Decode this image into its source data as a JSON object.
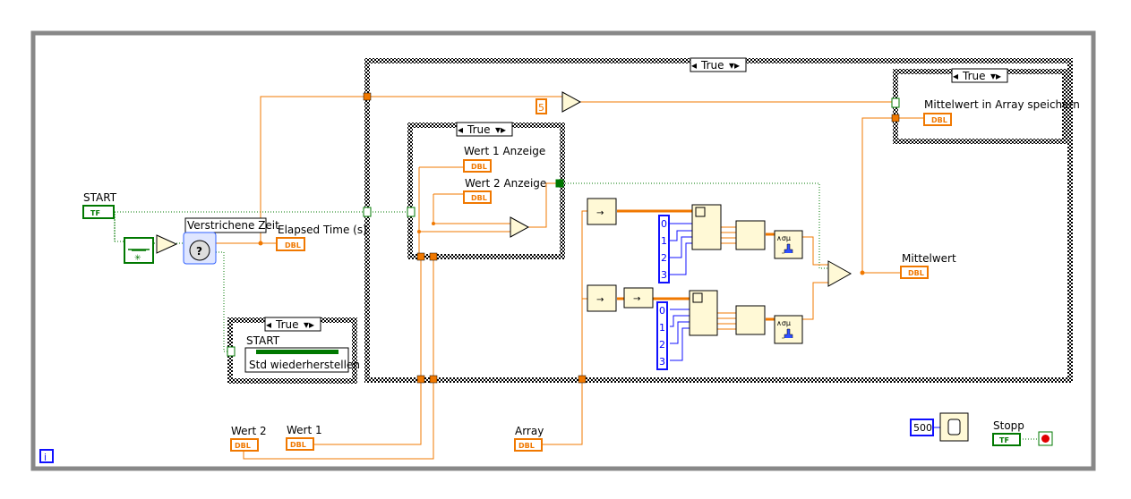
{
  "case_selector_value": "True",
  "controls": {
    "start": {
      "label": "START",
      "type": "TF"
    },
    "wert1": {
      "label": "Wert 1",
      "type": "DBL"
    },
    "wert2": {
      "label": "Wert 2",
      "type": "DBL"
    },
    "array": {
      "label": "Array",
      "type": "DBL"
    },
    "stopp": {
      "label": "Stopp",
      "type": "TF"
    }
  },
  "indicators": {
    "elapsed_time": {
      "label": "Elapsed Time (s)",
      "type": "DBL"
    },
    "wert1_anzeige": {
      "label": "Wert 1 Anzeige",
      "type": "DBL"
    },
    "wert2_anzeige": {
      "label": "Wert 2 Anzeige",
      "type": "DBL"
    },
    "mittelwert_array": {
      "label": "Mittelwert in Array speichern",
      "type": "DBL"
    },
    "mittelwert": {
      "label": "Mittelwert",
      "type": "DBL"
    }
  },
  "express_vi": {
    "label": "Verstrichene Zeit"
  },
  "property_node": {
    "label": "START",
    "property": "Std wiederherstellen"
  },
  "constants": {
    "five": "5",
    "wait_ms": "500",
    "index": [
      "0",
      "1",
      "2",
      "3"
    ]
  },
  "info_icon": "i",
  "colors": {
    "double_wire": "#f07800",
    "bool_wire": "#007800",
    "int_wire": "#1010ff",
    "structure_border": "#808080"
  }
}
